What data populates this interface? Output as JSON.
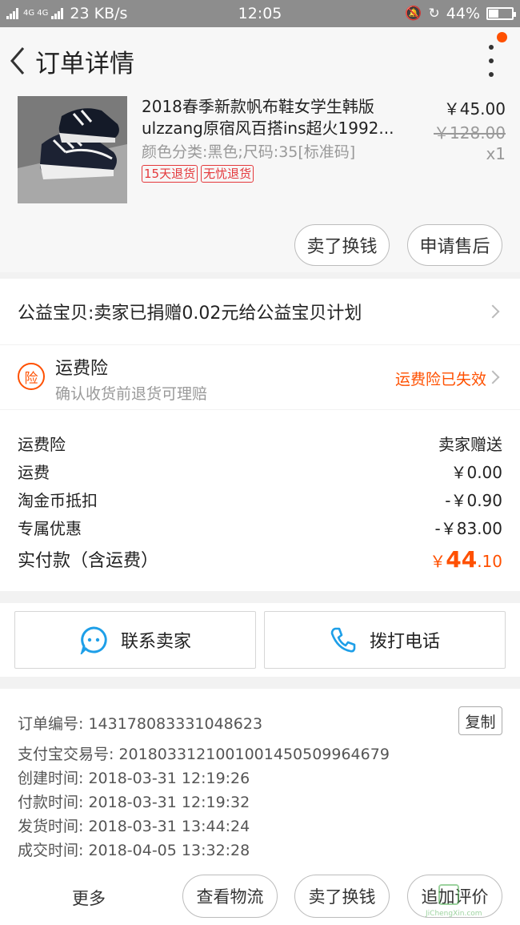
{
  "status_bar": {
    "network": "4G 4G",
    "speed": "23 KB/s",
    "time": "12:05",
    "battery": "44%",
    "battery_level": 0.44
  },
  "header": {
    "title": "订单详情"
  },
  "product": {
    "name_line1": "2018春季新款帆布鞋女学生韩版",
    "name_line2": "ulzzang原宿风百搭ins超火1992...",
    "spec": "颜色分类:黑色;尺码:35[标准码]",
    "tags": [
      "15天退货",
      "无忧退货"
    ],
    "price": "￥45.00",
    "original_price": "￥128.00",
    "quantity": "x1",
    "buttons": {
      "sell": "卖了换钱",
      "after_sale": "申请售后"
    }
  },
  "charity": {
    "text": "公益宝贝:卖家已捐赠0.02元给公益宝贝计划"
  },
  "insurance": {
    "icon_text": "险",
    "title": "运费险",
    "subtitle": "确认收货前退货可理赔",
    "status": "运费险已失效"
  },
  "fees": {
    "rows": [
      {
        "label": "运费险",
        "value": "卖家赠送"
      },
      {
        "label": "运费",
        "value": "￥0.00"
      },
      {
        "label": "淘金币抵扣",
        "value": "-￥0.90"
      },
      {
        "label": "专属优惠",
        "value": "-￥83.00"
      }
    ],
    "total_label": "实付款（含运费）",
    "total_symbol": "￥",
    "total_integer": "44",
    "total_decimal": ".10"
  },
  "contact": {
    "seller": "联系卖家",
    "call": "拨打电话"
  },
  "order_info": {
    "order_no": "订单编号: 143178083331048623",
    "copy": "复制",
    "alipay_no": "支付宝交易号: 2018033121001001450509964679",
    "created": "创建时间: 2018-03-31 12:19:26",
    "paid": "付款时间: 2018-03-31 12:19:32",
    "shipped": "发货时间: 2018-03-31 13:44:24",
    "completed": "成交时间: 2018-04-05 13:32:28"
  },
  "bottom_bar": {
    "more": "更多",
    "logistics": "查看物流",
    "sell": "卖了换钱",
    "review": "追加评价"
  },
  "watermark": {
    "text": "JiChengXin.com"
  },
  "colors": {
    "accent": "#ff5000",
    "tag_red": "#e4393c",
    "icon_blue": "#1e9fe8"
  }
}
